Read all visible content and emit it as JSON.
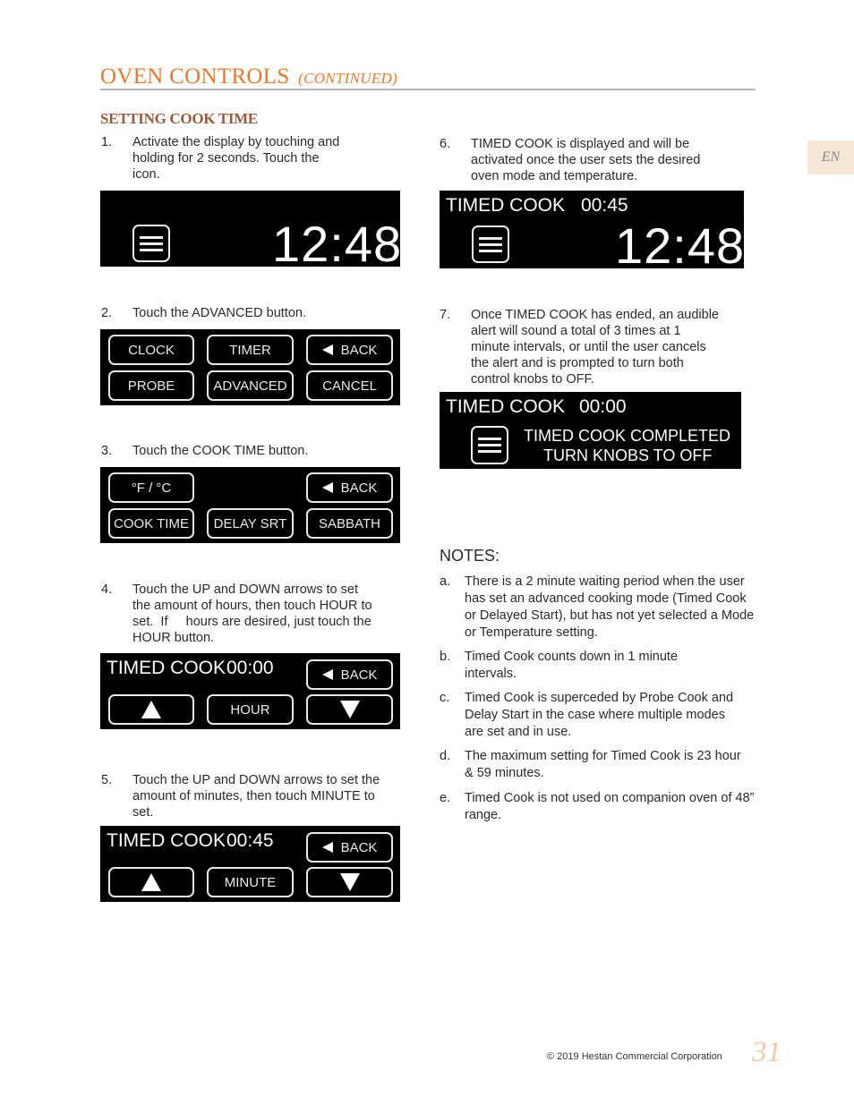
{
  "header": {
    "title": "OVEN CONTROLS",
    "continued": "(CONTINUED)"
  },
  "section_title": "SETTING COOK TIME",
  "lang_tab": "EN",
  "steps": [
    {
      "num": "1.",
      "lines": [
        "Activate the display by touching and",
        "holding for 2 seconds.  Touch the",
        "icon."
      ]
    },
    {
      "num": "2.",
      "lines": [
        "Touch the ADVANCED button."
      ]
    },
    {
      "num": "3.",
      "lines": [
        "Touch the COOK TIME button."
      ]
    },
    {
      "num": "4.",
      "lines": [
        "Touch the UP and DOWN arrows to set",
        "the amount of hours, then touch HOUR to",
        "set.  If     hours are desired, just touch the",
        "HOUR button."
      ]
    },
    {
      "num": "5.",
      "lines": [
        "Touch the UP and DOWN arrows to set the",
        "amount of minutes, then touch MINUTE to",
        "set."
      ]
    },
    {
      "num": "6.",
      "lines": [
        "TIMED COOK is displayed and will be",
        "activated once the user sets the desired",
        "oven mode and temperature."
      ]
    },
    {
      "num": "7.",
      "lines": [
        "Once TIMED COOK has ended, an audible",
        "alert will sound a total of 3 times at 1",
        "minute intervals, or until the user cancels",
        "the alert and is prompted to turn both",
        "control knobs to OFF."
      ]
    }
  ],
  "displays": {
    "d1": {
      "clock": "12:48"
    },
    "d2": {
      "buttons": [
        "CLOCK",
        "TIMER",
        "BACK",
        "PROBE",
        "ADVANCED",
        "CANCEL"
      ]
    },
    "d3": {
      "buttons": [
        "°F / °C",
        "BACK",
        "COOK TIME",
        "DELAY SRT",
        "SABBATH"
      ]
    },
    "d4": {
      "label": "TIMED COOK",
      "time": "00:00",
      "back": "BACK",
      "center": "HOUR"
    },
    "d5": {
      "label": "TIMED COOK",
      "time": "00:45",
      "back": "BACK",
      "center": "MINUTE"
    },
    "d6": {
      "label": "TIMED COOK",
      "time": "00:45",
      "clock": "12:48"
    },
    "d7": {
      "label": "TIMED COOK",
      "time": "00:00",
      "msg1": "TIMED COOK COMPLETED",
      "msg2": "TURN KNOBS TO OFF"
    }
  },
  "notes": {
    "title": "NOTES:",
    "items": [
      {
        "num": "a.",
        "text": "There is a 2 minute waiting period when the user has set an advanced cooking mode (Timed Cook or Delayed Start), but has not yet selected a Mode or Temperature setting."
      },
      {
        "num": "b.",
        "text": "Timed Cook counts down in 1 minute intervals."
      },
      {
        "num": "c.",
        "text": "Timed Cook is superceded by Probe Cook and Delay Start in the case where multiple modes are set and in use."
      },
      {
        "num": "d.",
        "text": "The maximum setting for Timed Cook is 23 hour & 59 minutes."
      },
      {
        "num": "e.",
        "text": "Timed Cook is not used on companion oven of 48” range."
      }
    ]
  },
  "footer": {
    "copyright": "© 2019 Hestan Commercial Corporation",
    "page": "31"
  }
}
